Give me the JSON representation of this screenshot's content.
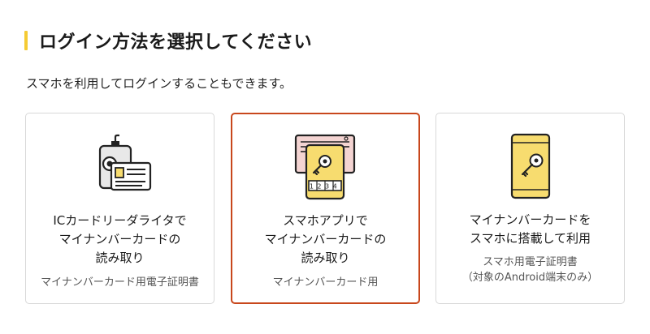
{
  "heading": {
    "title": "ログイン方法を選択してください"
  },
  "intro": "スマホを利用してログインすることもできます。",
  "cards": [
    {
      "icon": "card-reader-icon",
      "title_lines": [
        "ICカードリーダライタで",
        "マイナンバーカードの",
        "読み取り"
      ],
      "sub_lines": [
        "マイナンバーカード用電子証明書"
      ],
      "selected": false
    },
    {
      "icon": "smartphone-app-card-icon",
      "title_lines": [
        "スマホアプリで",
        "マイナンバーカードの",
        "読み取り"
      ],
      "sub_lines": [
        "マイナンバーカード用"
      ],
      "keypad": "1234",
      "selected": true
    },
    {
      "icon": "smartphone-key-icon",
      "title_lines": [
        "マイナンバーカードを",
        "スマホに搭載して利用"
      ],
      "sub_lines": [
        "スマホ用電子証明書",
        "（対象のAndroid端末のみ）"
      ],
      "selected": false
    }
  ],
  "colors": {
    "accent_bar": "#f5cb33",
    "selected_border": "#c8471c",
    "icon_yellow": "#f7dc6f",
    "icon_pink": "#f4d4d2",
    "icon_gray": "#e8e8e8"
  }
}
